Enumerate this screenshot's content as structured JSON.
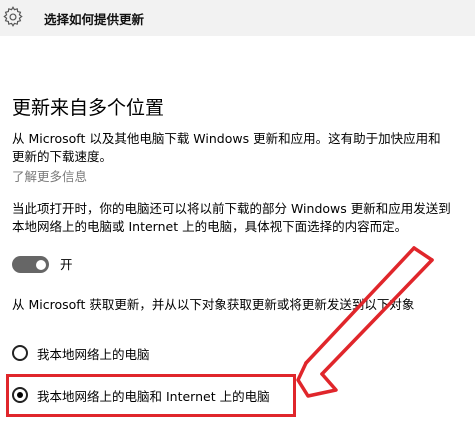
{
  "header": {
    "icon": "gear-icon",
    "title": "选择如何提供更新"
  },
  "section": {
    "heading": "更新来自多个位置",
    "description": "从 Microsoft 以及其他电脑下载 Windows 更新和应用。这有助于加快应用和更新的下载速度。",
    "learn_more": "了解更多信息",
    "detail": "当此项打开时，你的电脑还可以将以前下载的部分 Windows 更新和应用发送到本地网络上的电脑或 Internet 上的电脑，具体视下面选择的内容而定。",
    "toggle": {
      "state": "on",
      "label": "开"
    },
    "source_prompt": "从 Microsoft 获取更新，并从以下对象获取更新或将更新发送到以下对象",
    "options": [
      {
        "label": "我本地网络上的电脑",
        "selected": false
      },
      {
        "label": "我本地网络上的电脑和 Internet 上的电脑",
        "selected": true
      }
    ]
  },
  "annotation": {
    "color": "#e0262b"
  }
}
